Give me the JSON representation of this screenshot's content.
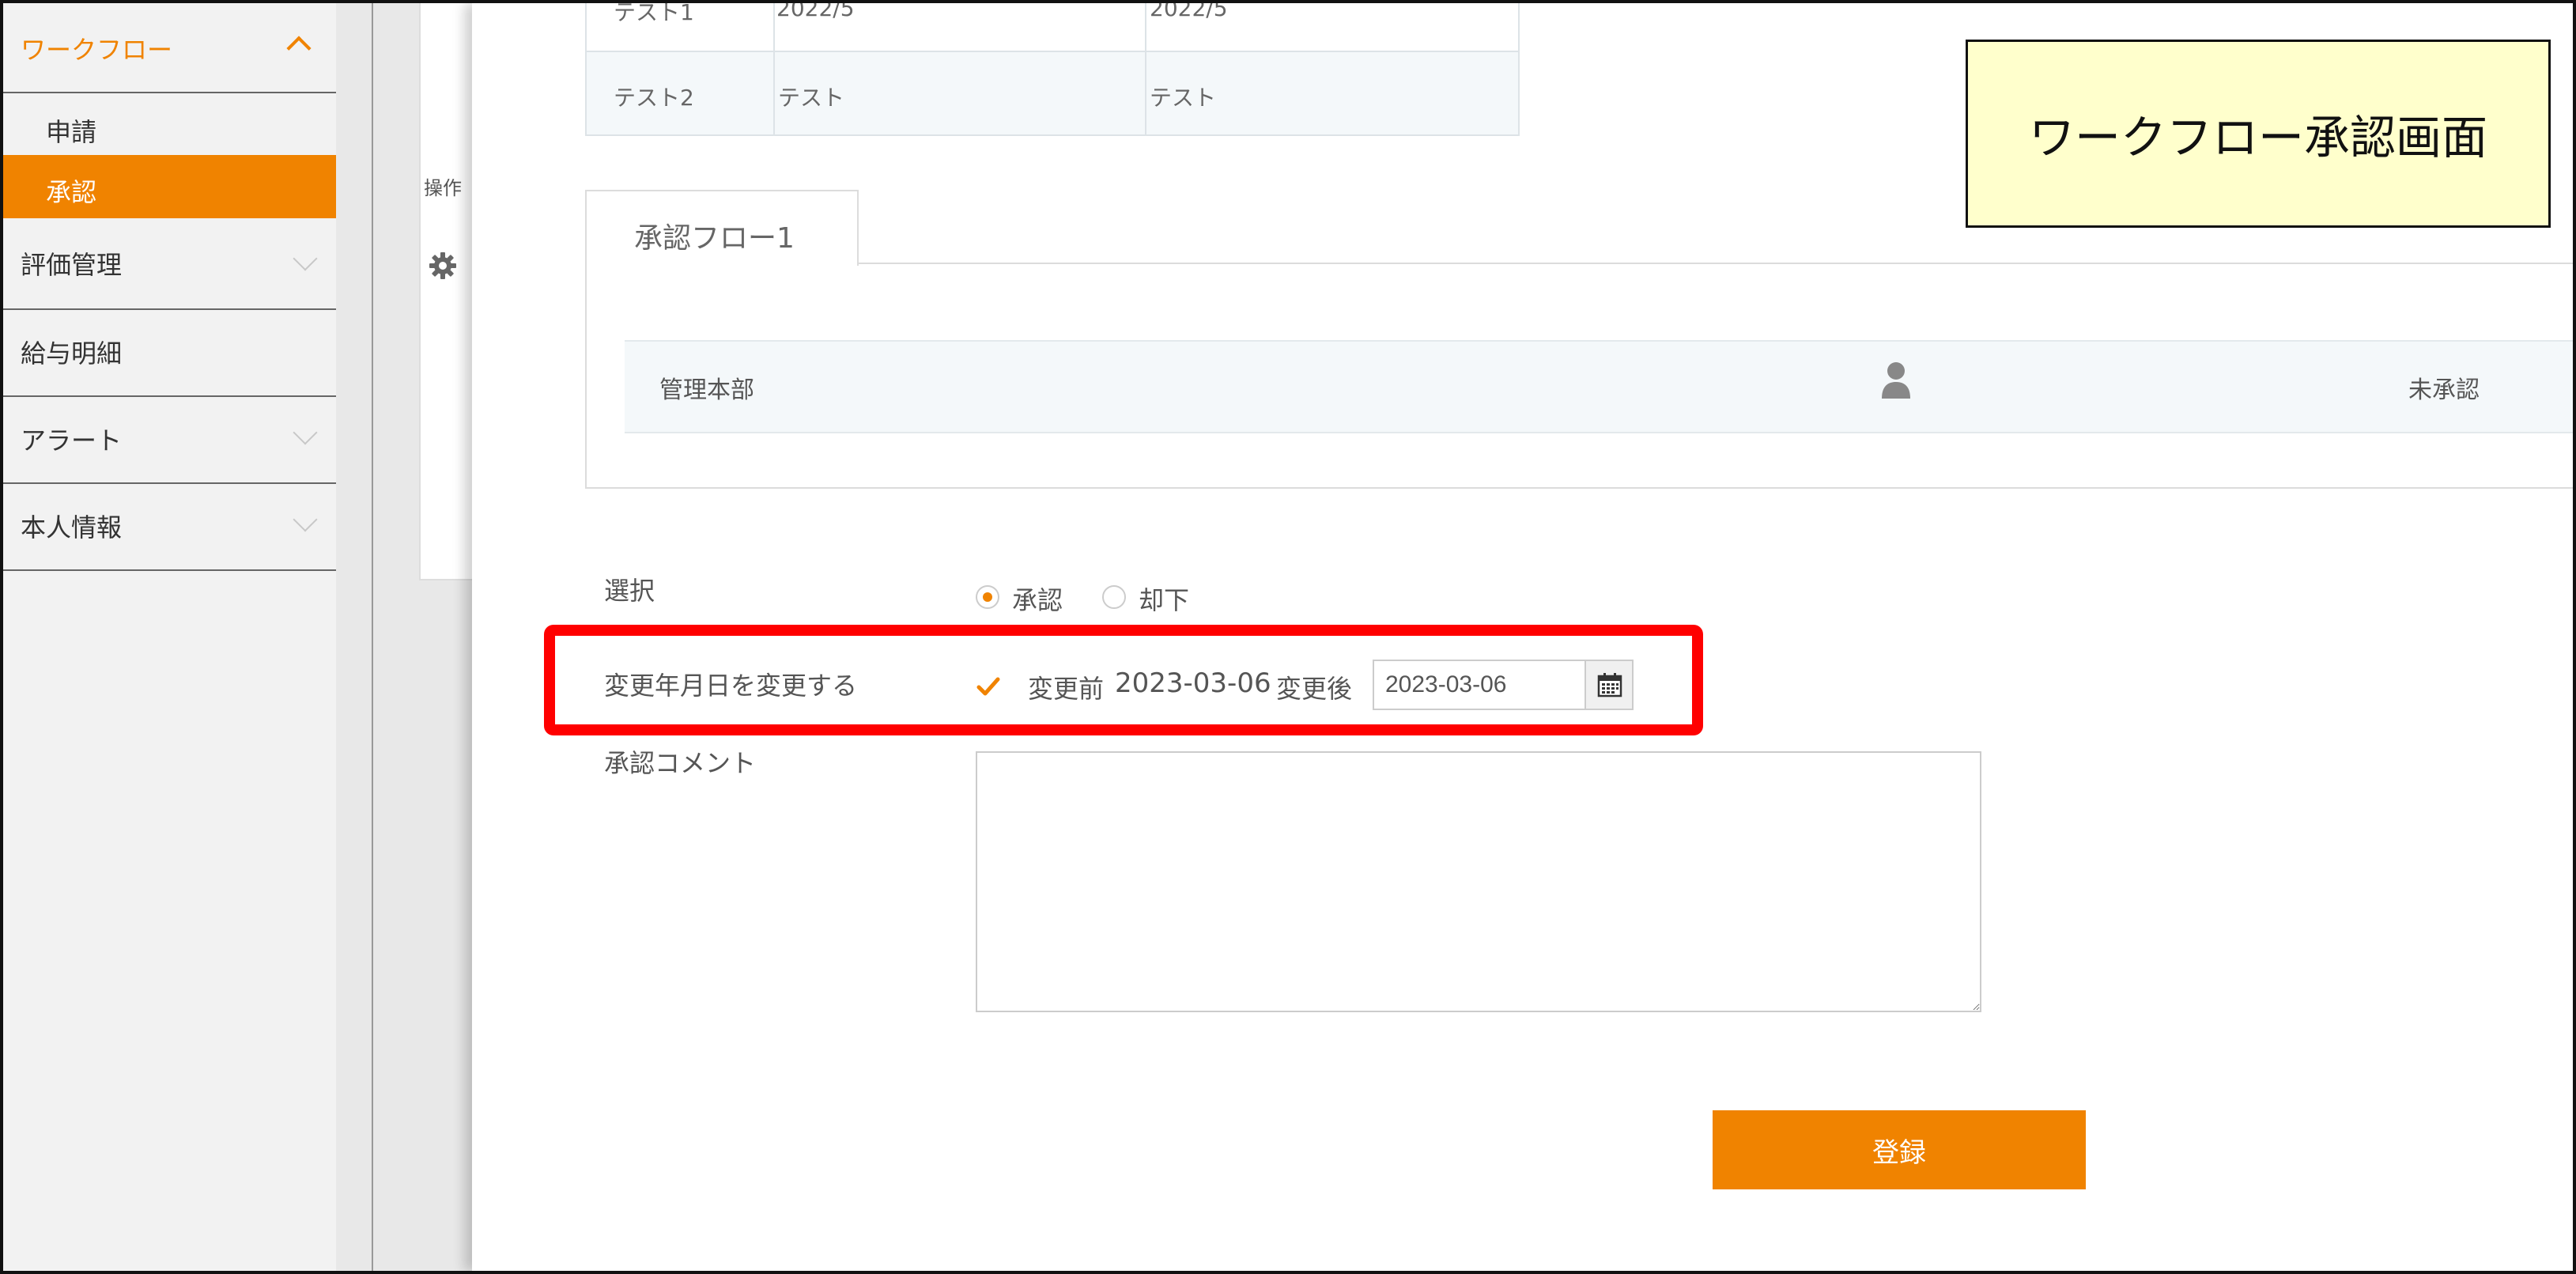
{
  "sidebar": {
    "workflow_label": "ワークフロー",
    "sub_items": [
      "申請",
      "承認"
    ],
    "items": [
      "評価管理",
      "給与明細",
      "アラート",
      "本人情報"
    ]
  },
  "background": {
    "ops_label": "操作"
  },
  "top_table": {
    "rows": [
      [
        "テスト1",
        "2022/5",
        "2022/5"
      ],
      [
        "テスト2",
        "テスト",
        "テスト"
      ]
    ]
  },
  "flow": {
    "tab_label": "承認フロー1",
    "rows": [
      {
        "department": "管理本部",
        "status": "未承認"
      }
    ]
  },
  "form": {
    "select_label": "選択",
    "options": [
      "承認",
      "却下"
    ],
    "selected_option": "承認",
    "change_date_label": "変更年月日を変更する",
    "change_date_checked": true,
    "before_label": "変更前",
    "before_date": "2023-03-06",
    "after_label": "変更後",
    "after_date_value": "2023-03-06",
    "comment_label": "承認コメント",
    "comment_value": "",
    "submit_label": "登録"
  },
  "callout": {
    "text": "ワークフロー承認画面"
  },
  "colors": {
    "accent": "#f08300",
    "highlight": "#ff0000",
    "callout_bg": "#ffffcc"
  },
  "icons": {
    "settings": "gear-icon",
    "person": "user-icon",
    "calendar": "calendar-icon",
    "check": "checkmark-icon"
  }
}
